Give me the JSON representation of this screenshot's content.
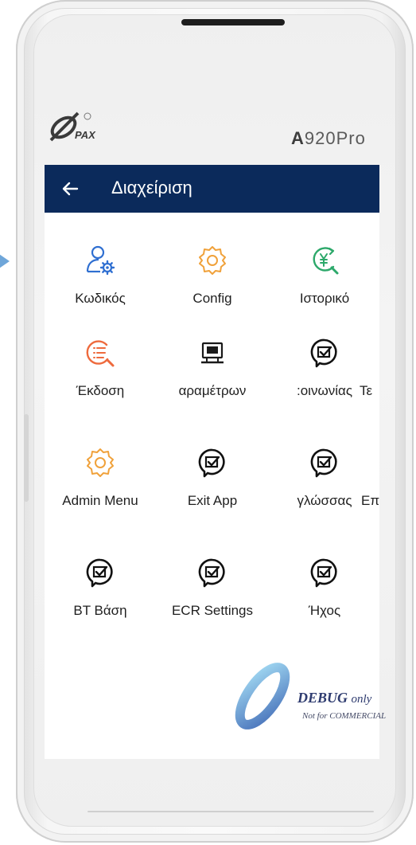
{
  "device": {
    "brand": "PAX",
    "model_bold": "A",
    "model_rest": "920Pro"
  },
  "titlebar": {
    "title": "Διαχείριση",
    "back_icon": "arrow-left-icon"
  },
  "grid": [
    {
      "label": "Κωδικός",
      "icon": "user-gear-icon",
      "color": "#2f6fd1"
    },
    {
      "label": "Config",
      "icon": "gear-icon",
      "color": "#f0a13a"
    },
    {
      "label": "Ιστορικό",
      "icon": "yen-history-icon",
      "color": "#2ca86a"
    },
    {
      "label": "Έκδοση",
      "icon": "list-search-icon",
      "color": "#ee6a3d"
    },
    {
      "label": "αραμέτρων",
      "icon": "terminal-icon",
      "color": "#1a1a1a"
    },
    {
      "label": ":οινωνίας",
      "icon": "chat-check-icon",
      "color": "#111111"
    },
    {
      "label": "Τε",
      "icon": "",
      "color": "#111111"
    },
    {
      "label": "Admin Menu",
      "icon": "gear-icon",
      "color": "#f0a13a"
    },
    {
      "label": "Exit App",
      "icon": "chat-check-icon",
      "color": "#111111"
    },
    {
      "label": "γλώσσας",
      "icon": "chat-check-icon",
      "color": "#111111"
    },
    {
      "label": "Επ",
      "icon": "",
      "color": "#111111"
    },
    {
      "label": "BT Βάση",
      "icon": "chat-check-icon",
      "color": "#111111"
    },
    {
      "label": "ECR Settings",
      "icon": "chat-check-icon",
      "color": "#111111"
    },
    {
      "label": "Ήχος",
      "icon": "chat-check-icon",
      "color": "#111111"
    }
  ],
  "watermark": {
    "line1": "DEBUG",
    "line1_suffix": "only",
    "line2": "Not for COMMERCIAL"
  }
}
